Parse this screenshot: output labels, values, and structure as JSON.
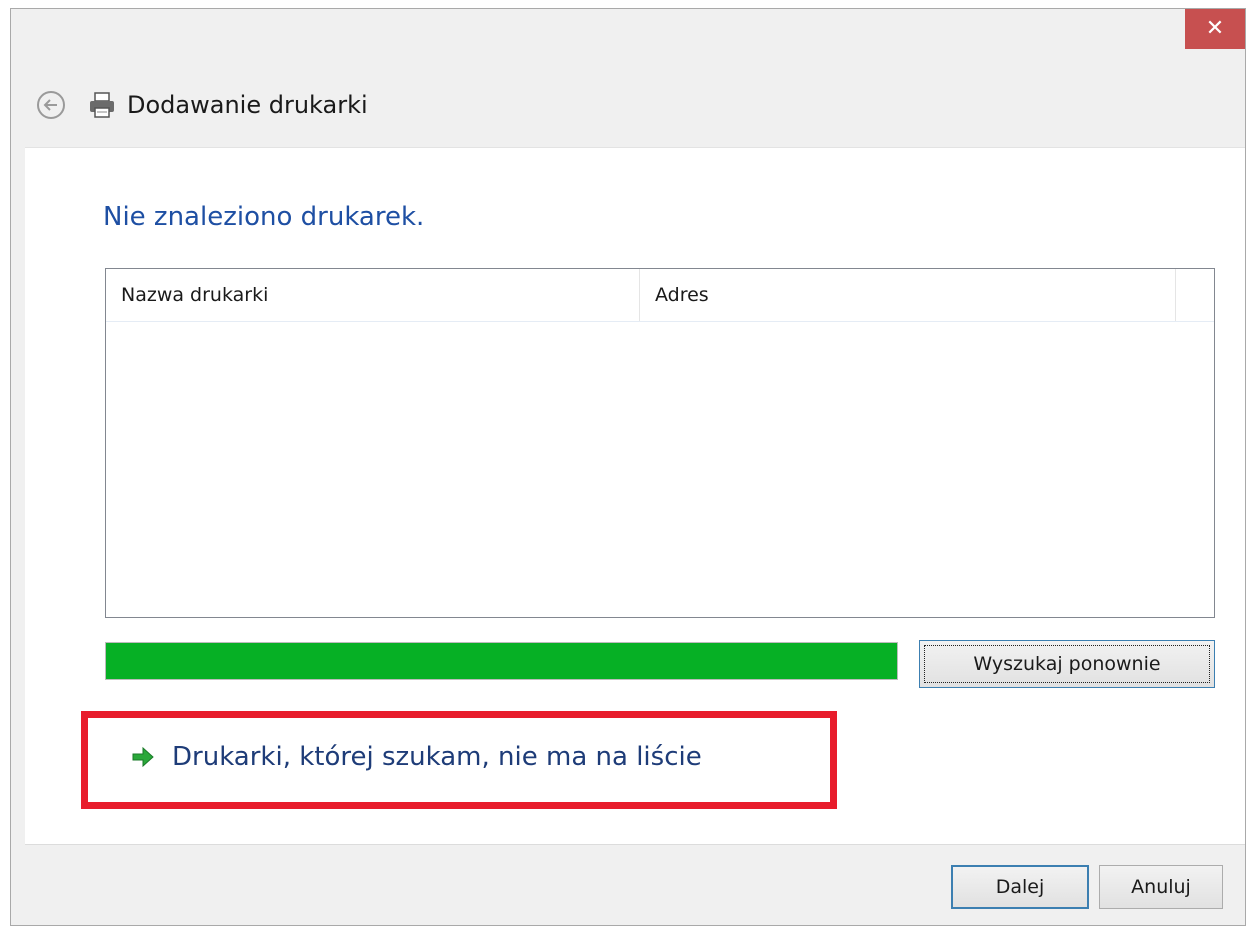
{
  "window": {
    "title": "Dodawanie drukarki",
    "close_label": "✕"
  },
  "main": {
    "heading": "Nie znaleziono drukarek.",
    "columns": [
      "Nazwa drukarki",
      "Adres"
    ],
    "rows": [],
    "search_again_label": "Wyszukaj ponownie",
    "search_progress_percent": 100,
    "link_label": "Drukarki, której szukam, nie ma na liście"
  },
  "footer": {
    "next_label": "Dalej",
    "cancel_label": "Anuluj"
  },
  "colors": {
    "heading": "#1e4fa3",
    "progress": "#06b025",
    "highlight_box": "#e81c2c",
    "close_button": "#c75050"
  }
}
